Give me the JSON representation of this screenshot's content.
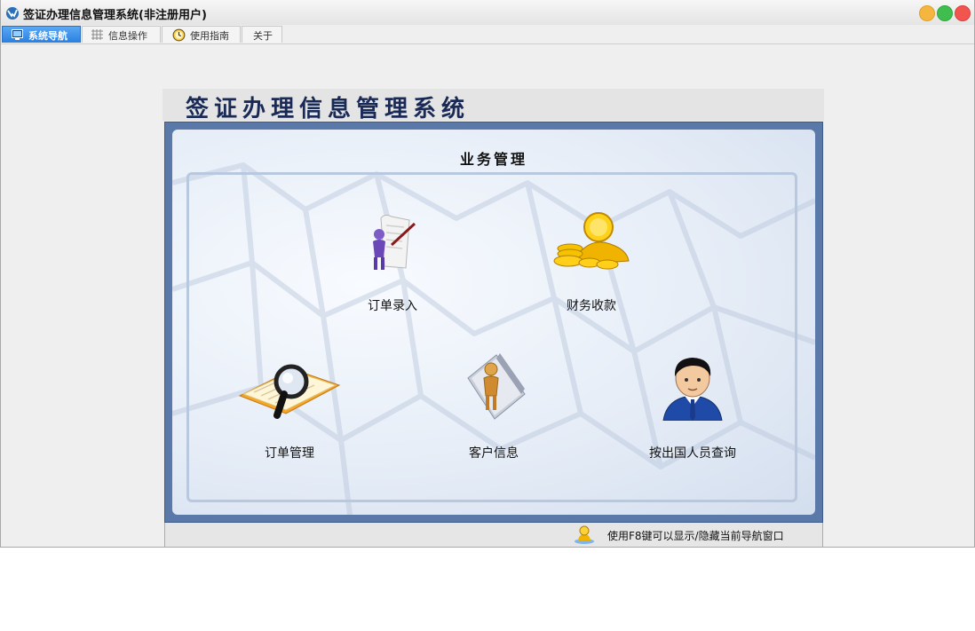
{
  "window": {
    "title": "签证办理信息管理系统(非注册用户)"
  },
  "tabs": [
    {
      "label": "系统导航",
      "icon": "monitor-icon",
      "active": true
    },
    {
      "label": "信息操作",
      "icon": "grid-icon",
      "active": false
    },
    {
      "label": "使用指南",
      "icon": "clock-icon",
      "active": false
    },
    {
      "label": "关于",
      "icon": "",
      "active": false
    }
  ],
  "nav": {
    "header_title": "签证办理信息管理系统",
    "section_title": "业务管理",
    "items": [
      {
        "label": "订单录入",
        "icon": "order-entry-icon"
      },
      {
        "label": "财务收款",
        "icon": "finance-coins-icon"
      },
      {
        "label": "订单管理",
        "icon": "magnifier-book-icon"
      },
      {
        "label": "客户信息",
        "icon": "customer-figure-icon"
      },
      {
        "label": "按出国人员查询",
        "icon": "person-query-icon"
      }
    ]
  },
  "status": {
    "text": "使用F8键可以显示/隐藏当前导航窗口",
    "icon": "user-hint-icon"
  },
  "colors": {
    "tab_active": "#2a7fe0",
    "panel_border": "#5a78a8",
    "title": "#1a2a56"
  }
}
